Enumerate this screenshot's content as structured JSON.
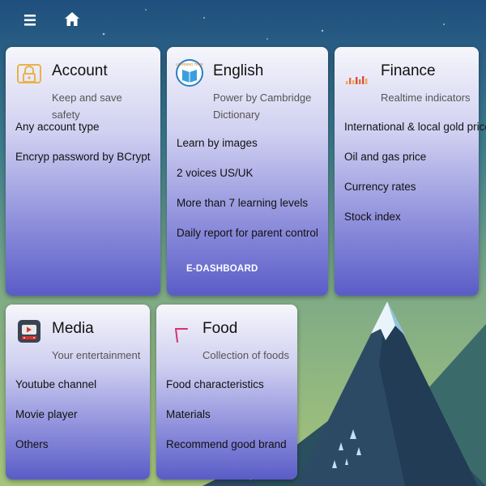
{
  "cards": {
    "account": {
      "icon": "lock-icon",
      "title": "Account",
      "subtitle": "Keep and save safety",
      "features": [
        "Any account type",
        "Encryp password by BCrypt"
      ]
    },
    "english": {
      "icon": "english-logo-icon",
      "logo_text": "LEARNING TREE",
      "title": "English",
      "subtitle": "Power by Cambridge Dictionary",
      "features": [
        "Learn by images",
        "2 voices US/UK",
        "More than 7 learning levels",
        "Daily report for parent control"
      ],
      "action_label": "E-DASHBOARD"
    },
    "finance": {
      "icon": "bar-chart-icon",
      "title": "Finance",
      "subtitle": "Realtime indicators",
      "features": [
        "International & local gold price",
        "Oil and gas price",
        "Currency rates",
        "Stock index"
      ]
    },
    "media": {
      "icon": "media-player-icon",
      "title": "Media",
      "subtitle": "Your entertainment",
      "features": [
        "Youtube channel",
        "Movie player",
        "Others"
      ]
    },
    "food": {
      "icon": "food-icon",
      "title": "Food",
      "subtitle": "Collection of foods",
      "features": [
        "Food characteristics",
        "Materials",
        "Recommend good brand"
      ]
    }
  },
  "topbar": {
    "menu_icon": "hamburger-menu-icon",
    "home_icon": "home-icon"
  },
  "colors": {
    "card_top": "#f6f6fb",
    "card_bottom": "#5a5cc7",
    "action_text": "#ffffff"
  }
}
